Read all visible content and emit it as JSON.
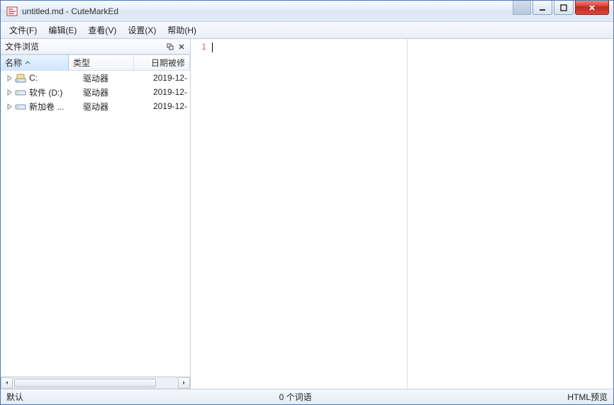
{
  "window": {
    "title": "untitled.md - CuteMarkEd"
  },
  "menu": {
    "file": "文件(F)",
    "edit": "编辑(E)",
    "view": "查看(V)",
    "settings": "设置(X)",
    "help": "帮助(H)"
  },
  "sidebar": {
    "panel_title": "文件浏览",
    "columns": {
      "name": "名称",
      "type": "类型",
      "date": "日期被修"
    },
    "rows": [
      {
        "name": "C:",
        "type": "驱动器",
        "date": "2019-12-",
        "icon": "drive-system"
      },
      {
        "name": "软件 (D:)",
        "type": "驱动器",
        "date": "2019-12-",
        "icon": "drive"
      },
      {
        "name": "新加卷 ...",
        "type": "驱动器",
        "date": "2019-12-",
        "icon": "drive"
      }
    ]
  },
  "editor": {
    "line_number": "1"
  },
  "status": {
    "left": "默认",
    "center": "0 个词语",
    "right": "HTML预览"
  }
}
